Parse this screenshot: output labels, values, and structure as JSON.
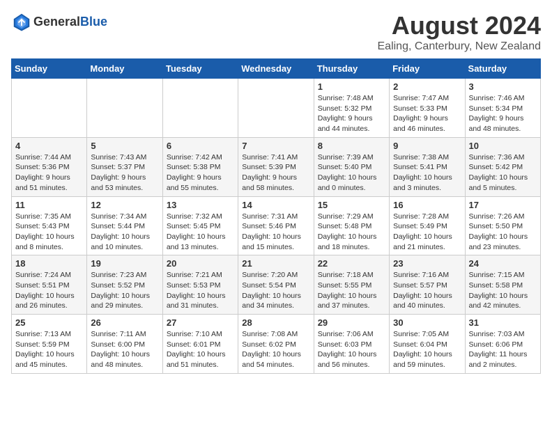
{
  "header": {
    "logo_general": "General",
    "logo_blue": "Blue",
    "month_year": "August 2024",
    "location": "Ealing, Canterbury, New Zealand"
  },
  "weekdays": [
    "Sunday",
    "Monday",
    "Tuesday",
    "Wednesday",
    "Thursday",
    "Friday",
    "Saturday"
  ],
  "weeks": [
    [
      {
        "day": "",
        "content": ""
      },
      {
        "day": "",
        "content": ""
      },
      {
        "day": "",
        "content": ""
      },
      {
        "day": "",
        "content": ""
      },
      {
        "day": "1",
        "content": "Sunrise: 7:48 AM\nSunset: 5:32 PM\nDaylight: 9 hours\nand 44 minutes."
      },
      {
        "day": "2",
        "content": "Sunrise: 7:47 AM\nSunset: 5:33 PM\nDaylight: 9 hours\nand 46 minutes."
      },
      {
        "day": "3",
        "content": "Sunrise: 7:46 AM\nSunset: 5:34 PM\nDaylight: 9 hours\nand 48 minutes."
      }
    ],
    [
      {
        "day": "4",
        "content": "Sunrise: 7:44 AM\nSunset: 5:36 PM\nDaylight: 9 hours\nand 51 minutes."
      },
      {
        "day": "5",
        "content": "Sunrise: 7:43 AM\nSunset: 5:37 PM\nDaylight: 9 hours\nand 53 minutes."
      },
      {
        "day": "6",
        "content": "Sunrise: 7:42 AM\nSunset: 5:38 PM\nDaylight: 9 hours\nand 55 minutes."
      },
      {
        "day": "7",
        "content": "Sunrise: 7:41 AM\nSunset: 5:39 PM\nDaylight: 9 hours\nand 58 minutes."
      },
      {
        "day": "8",
        "content": "Sunrise: 7:39 AM\nSunset: 5:40 PM\nDaylight: 10 hours\nand 0 minutes."
      },
      {
        "day": "9",
        "content": "Sunrise: 7:38 AM\nSunset: 5:41 PM\nDaylight: 10 hours\nand 3 minutes."
      },
      {
        "day": "10",
        "content": "Sunrise: 7:36 AM\nSunset: 5:42 PM\nDaylight: 10 hours\nand 5 minutes."
      }
    ],
    [
      {
        "day": "11",
        "content": "Sunrise: 7:35 AM\nSunset: 5:43 PM\nDaylight: 10 hours\nand 8 minutes."
      },
      {
        "day": "12",
        "content": "Sunrise: 7:34 AM\nSunset: 5:44 PM\nDaylight: 10 hours\nand 10 minutes."
      },
      {
        "day": "13",
        "content": "Sunrise: 7:32 AM\nSunset: 5:45 PM\nDaylight: 10 hours\nand 13 minutes."
      },
      {
        "day": "14",
        "content": "Sunrise: 7:31 AM\nSunset: 5:46 PM\nDaylight: 10 hours\nand 15 minutes."
      },
      {
        "day": "15",
        "content": "Sunrise: 7:29 AM\nSunset: 5:48 PM\nDaylight: 10 hours\nand 18 minutes."
      },
      {
        "day": "16",
        "content": "Sunrise: 7:28 AM\nSunset: 5:49 PM\nDaylight: 10 hours\nand 21 minutes."
      },
      {
        "day": "17",
        "content": "Sunrise: 7:26 AM\nSunset: 5:50 PM\nDaylight: 10 hours\nand 23 minutes."
      }
    ],
    [
      {
        "day": "18",
        "content": "Sunrise: 7:24 AM\nSunset: 5:51 PM\nDaylight: 10 hours\nand 26 minutes."
      },
      {
        "day": "19",
        "content": "Sunrise: 7:23 AM\nSunset: 5:52 PM\nDaylight: 10 hours\nand 29 minutes."
      },
      {
        "day": "20",
        "content": "Sunrise: 7:21 AM\nSunset: 5:53 PM\nDaylight: 10 hours\nand 31 minutes."
      },
      {
        "day": "21",
        "content": "Sunrise: 7:20 AM\nSunset: 5:54 PM\nDaylight: 10 hours\nand 34 minutes."
      },
      {
        "day": "22",
        "content": "Sunrise: 7:18 AM\nSunset: 5:55 PM\nDaylight: 10 hours\nand 37 minutes."
      },
      {
        "day": "23",
        "content": "Sunrise: 7:16 AM\nSunset: 5:57 PM\nDaylight: 10 hours\nand 40 minutes."
      },
      {
        "day": "24",
        "content": "Sunrise: 7:15 AM\nSunset: 5:58 PM\nDaylight: 10 hours\nand 42 minutes."
      }
    ],
    [
      {
        "day": "25",
        "content": "Sunrise: 7:13 AM\nSunset: 5:59 PM\nDaylight: 10 hours\nand 45 minutes."
      },
      {
        "day": "26",
        "content": "Sunrise: 7:11 AM\nSunset: 6:00 PM\nDaylight: 10 hours\nand 48 minutes."
      },
      {
        "day": "27",
        "content": "Sunrise: 7:10 AM\nSunset: 6:01 PM\nDaylight: 10 hours\nand 51 minutes."
      },
      {
        "day": "28",
        "content": "Sunrise: 7:08 AM\nSunset: 6:02 PM\nDaylight: 10 hours\nand 54 minutes."
      },
      {
        "day": "29",
        "content": "Sunrise: 7:06 AM\nSunset: 6:03 PM\nDaylight: 10 hours\nand 56 minutes."
      },
      {
        "day": "30",
        "content": "Sunrise: 7:05 AM\nSunset: 6:04 PM\nDaylight: 10 hours\nand 59 minutes."
      },
      {
        "day": "31",
        "content": "Sunrise: 7:03 AM\nSunset: 6:06 PM\nDaylight: 11 hours\nand 2 minutes."
      }
    ]
  ]
}
